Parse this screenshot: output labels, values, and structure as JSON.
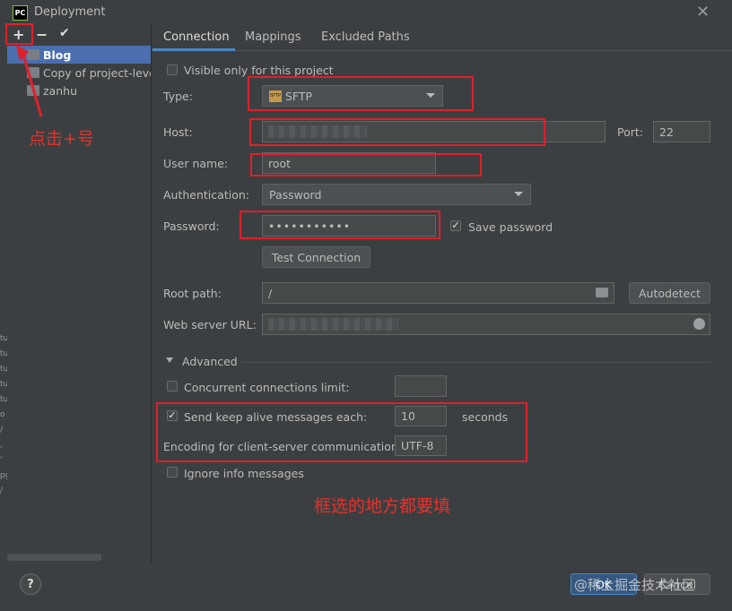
{
  "window": {
    "title": "Deployment",
    "app_icon": "PC"
  },
  "toolbar": {
    "add": "+",
    "remove": "−",
    "apply": "✔"
  },
  "tree": [
    "Blog",
    "Copy of project-level",
    "zanhu"
  ],
  "tabs": [
    "Connection",
    "Mappings",
    "Excluded Paths"
  ],
  "visible_only": "Visible only for this project",
  "type": {
    "label": "Type:",
    "value": "SFTP",
    "icon_text": "SFTP"
  },
  "host": {
    "label": "Host:",
    "value": ""
  },
  "port": {
    "label": "Port:",
    "value": "22"
  },
  "user": {
    "label": "User name:",
    "value": "root"
  },
  "auth": {
    "label": "Authentication:",
    "value": "Password"
  },
  "password": {
    "label": "Password:",
    "value": "•••••••••••",
    "save": "Save password"
  },
  "test_button": "Test Connection",
  "root_path": {
    "label": "Root path:",
    "value": "/",
    "autodetect": "Autodetect"
  },
  "web_url": {
    "label": "Web server URL:",
    "value": ""
  },
  "advanced": {
    "title": "Advanced",
    "concurrent": "Concurrent connections limit:",
    "keep_alive": "Send keep alive messages each:",
    "keep_alive_value": "10",
    "seconds": "seconds",
    "encoding_label": "Encoding for client-server communication:",
    "encoding_value": "UTF-8",
    "ignore": "Ignore info messages"
  },
  "annotations": {
    "plus": "点击+号",
    "fields": "框选的地方都要填"
  },
  "footer": {
    "help": "?",
    "ok": "OK",
    "cancel": "Cancel",
    "watermark": "@稀土掘金技术社区"
  },
  "gutter": [
    "tu",
    "tu",
    "tu",
    "tu",
    "tu",
    "o",
    "/",
    ",",
    "'",
    "pg",
    "/"
  ],
  "colors": {
    "accent": "#4a88c7",
    "annotation": "#e0202a",
    "selection": "#4b6eaf"
  }
}
